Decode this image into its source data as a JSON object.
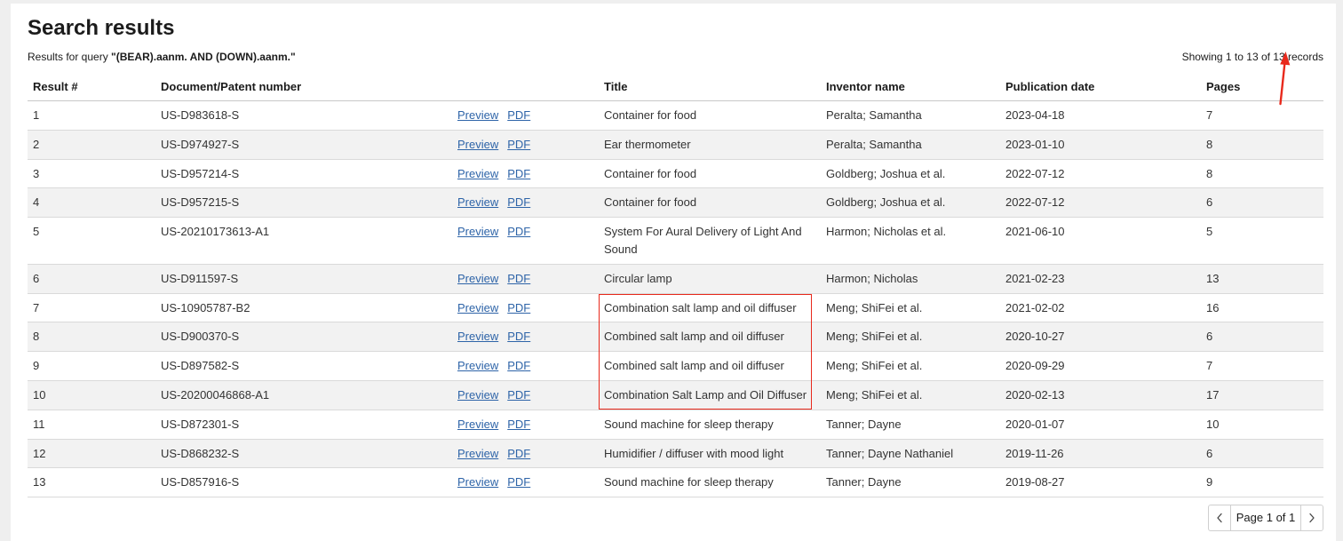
{
  "page": {
    "title": "Search results",
    "query_prefix": "Results for query ",
    "query": "\"(BEAR).aanm. AND (DOWN).aanm.\"",
    "record_summary": "Showing 1 to 13 of 13 records"
  },
  "table": {
    "headers": {
      "result": "Result #",
      "doc": "Document/Patent number",
      "title": "Title",
      "inventor": "Inventor name",
      "date": "Publication date",
      "pages": "Pages"
    },
    "link_labels": {
      "preview": "Preview",
      "pdf": "PDF"
    },
    "rows": [
      {
        "result": "1",
        "doc": "US-D983618-S",
        "title": "Container for food",
        "inventor": "Peralta; Samantha",
        "date": "2023-04-18",
        "pages": "7"
      },
      {
        "result": "2",
        "doc": "US-D974927-S",
        "title": "Ear thermometer",
        "inventor": "Peralta; Samantha",
        "date": "2023-01-10",
        "pages": "8"
      },
      {
        "result": "3",
        "doc": "US-D957214-S",
        "title": "Container for food",
        "inventor": "Goldberg; Joshua et al.",
        "date": "2022-07-12",
        "pages": "8"
      },
      {
        "result": "4",
        "doc": "US-D957215-S",
        "title": "Container for food",
        "inventor": "Goldberg; Joshua et al.",
        "date": "2022-07-12",
        "pages": "6"
      },
      {
        "result": "5",
        "doc": "US-20210173613-A1",
        "title": "System For Aural Delivery of Light And Sound",
        "inventor": "Harmon; Nicholas et al.",
        "date": "2021-06-10",
        "pages": "5"
      },
      {
        "result": "6",
        "doc": "US-D911597-S",
        "title": "Circular lamp",
        "inventor": "Harmon; Nicholas",
        "date": "2021-02-23",
        "pages": "13"
      },
      {
        "result": "7",
        "doc": "US-10905787-B2",
        "title": "Combination salt lamp and oil diffuser",
        "inventor": "Meng; ShiFei et al.",
        "date": "2021-02-02",
        "pages": "16"
      },
      {
        "result": "8",
        "doc": "US-D900370-S",
        "title": "Combined salt lamp and oil diffuser",
        "inventor": "Meng; ShiFei et al.",
        "date": "2020-10-27",
        "pages": "6"
      },
      {
        "result": "9",
        "doc": "US-D897582-S",
        "title": "Combined salt lamp and oil diffuser",
        "inventor": "Meng; ShiFei et al.",
        "date": "2020-09-29",
        "pages": "7"
      },
      {
        "result": "10",
        "doc": "US-20200046868-A1",
        "title": "Combination Salt Lamp and Oil Diffuser",
        "inventor": "Meng; ShiFei et al.",
        "date": "2020-02-13",
        "pages": "17"
      },
      {
        "result": "11",
        "doc": "US-D872301-S",
        "title": "Sound machine for sleep therapy",
        "inventor": "Tanner; Dayne",
        "date": "2020-01-07",
        "pages": "10"
      },
      {
        "result": "12",
        "doc": "US-D868232-S",
        "title": "Humidifier / diffuser with mood light",
        "inventor": "Tanner; Dayne Nathaniel",
        "date": "2019-11-26",
        "pages": "6"
      },
      {
        "result": "13",
        "doc": "US-D857916-S",
        "title": "Sound machine for sleep therapy",
        "inventor": "Tanner; Dayne",
        "date": "2019-08-27",
        "pages": "9"
      }
    ]
  },
  "pagination": {
    "prev_icon": "chevron-left-icon",
    "label": "Page 1 of 1",
    "next_icon": "chevron-right-icon"
  },
  "colors": {
    "link": "#2e64a8",
    "row_stripe": "#f2f2f2",
    "annotation": "#e8291c"
  }
}
